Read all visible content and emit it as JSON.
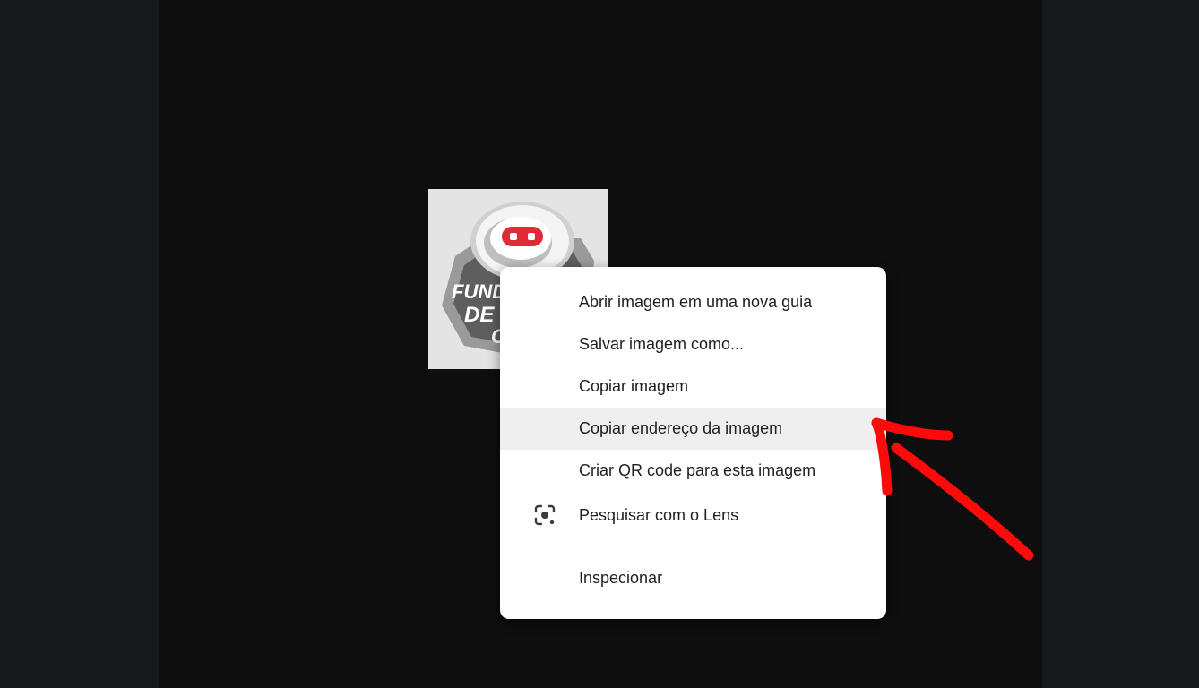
{
  "context_menu": {
    "items": [
      {
        "label": "Abrir imagem em uma nova guia"
      },
      {
        "label": "Salvar imagem como..."
      },
      {
        "label": "Copiar imagem"
      },
      {
        "label": "Copiar endereço da imagem",
        "highlighted": true
      },
      {
        "label": "Criar QR code para esta imagem"
      },
      {
        "label": "Pesquisar com o Lens",
        "icon": "lens-icon"
      },
      {
        "label": "Inspecionar"
      }
    ]
  },
  "image": {
    "logo_text_line1": "FUND",
    "logo_text_line2": "DE I",
    "logo_text_line3": "C"
  },
  "colors": {
    "annotation_arrow": "#ff0a0a",
    "robot_eyes": "#e02a36",
    "highlight": "#efefef"
  },
  "icons": {
    "lens": "lens-icon",
    "annotation": "red-arrow-annotation"
  }
}
